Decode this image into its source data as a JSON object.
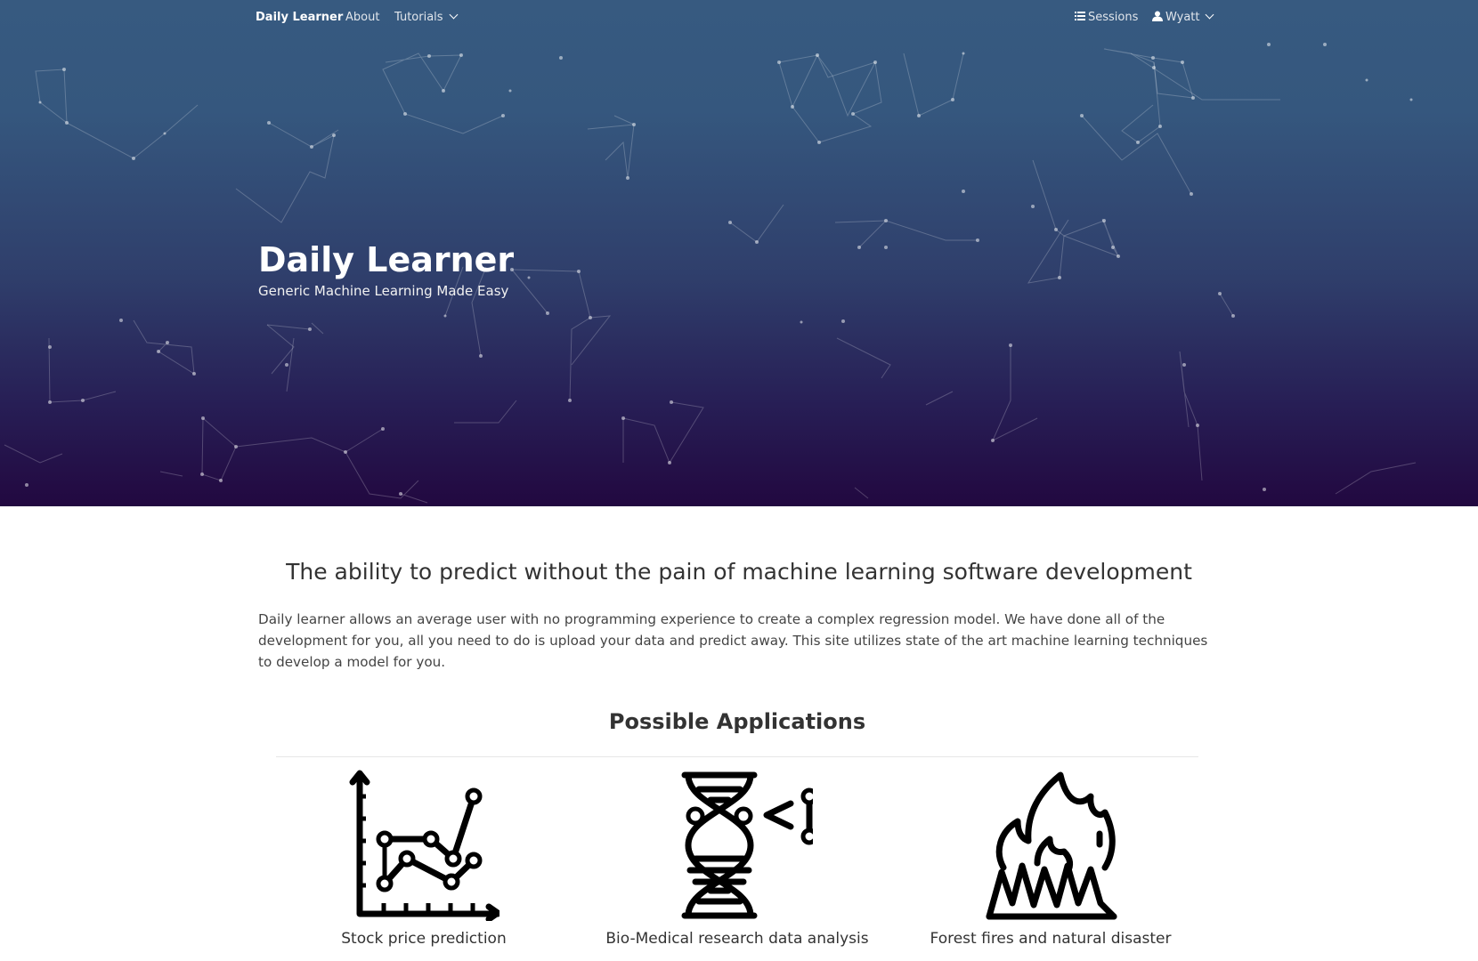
{
  "nav": {
    "brand": "Daily Learner",
    "about": "About",
    "tutorials": "Tutorials",
    "sessions": "Sessions",
    "user": "Wyatt"
  },
  "hero": {
    "title": "Daily Learner",
    "subtitle": "Generic Machine Learning Made Easy"
  },
  "main": {
    "heading": "The ability to predict without the pain of machine learning software development",
    "intro": "Daily learner allows an average user with no programming experience to create a complex regression model. We have done all of the development for you, all you need to do is upload your data and predict away. This site utilizes state of the art machine learning techniques to develop a model for you.",
    "applications_title": "Possible Applications",
    "applications": [
      {
        "label": "Stock price prediction",
        "icon": "line-chart-icon"
      },
      {
        "label": "Bio-Medical research data analysis",
        "icon": "dna-icon"
      },
      {
        "label": "Forest fires and natural disaster",
        "icon": "fire-icon"
      }
    ]
  },
  "colors": {
    "hero_top": "#375a80",
    "hero_bottom": "#220840",
    "text": "#333333"
  }
}
